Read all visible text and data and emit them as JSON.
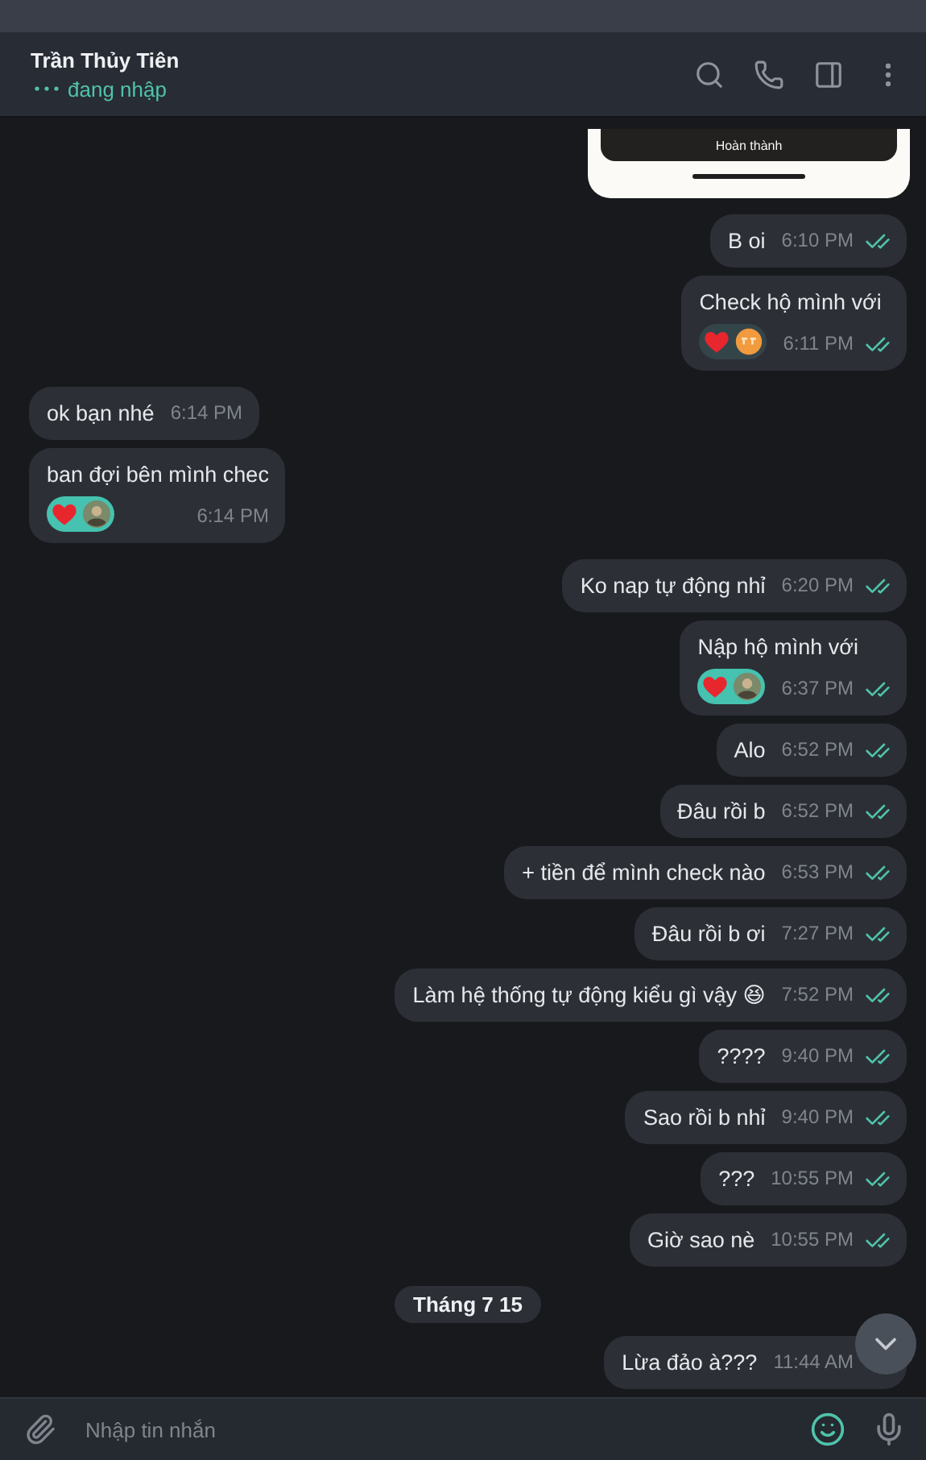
{
  "header": {
    "title": "Trần Thủy Tiên",
    "status": "đang nhập",
    "typing": true
  },
  "messages": [
    {
      "kind": "screenshot",
      "button": "Hoàn thành"
    },
    {
      "kind": "out",
      "text": "B oi",
      "time": "6:10 PM",
      "read": true
    },
    {
      "kind": "out",
      "text": "Check hộ mình với",
      "time": "6:11 PM",
      "read": true,
      "reactions": {
        "selected": false,
        "items": [
          {
            "kind": "heart"
          },
          {
            "kind": "emoji"
          }
        ]
      }
    },
    {
      "kind": "in",
      "text": "ok bạn nhé",
      "time": "6:14 PM"
    },
    {
      "kind": "in",
      "text": "ban đợi bên mình chec",
      "time": "6:14 PM",
      "reactions": {
        "selected": true,
        "items": [
          {
            "kind": "heart"
          },
          {
            "kind": "avatar"
          }
        ]
      }
    },
    {
      "kind": "out",
      "text": "Ko nap tự động nhỉ",
      "time": "6:20 PM",
      "read": true
    },
    {
      "kind": "out",
      "text": "Nập hộ mình với",
      "time": "6:37 PM",
      "read": true,
      "reactions": {
        "selected": true,
        "items": [
          {
            "kind": "heart"
          },
          {
            "kind": "avatar"
          }
        ]
      }
    },
    {
      "kind": "out",
      "text": "Alo",
      "time": "6:52 PM",
      "read": true
    },
    {
      "kind": "out",
      "text": "Đâu rồi b",
      "time": "6:52 PM",
      "read": true
    },
    {
      "kind": "out",
      "text": "+ tiền để mình check nào",
      "time": "6:53 PM",
      "read": true
    },
    {
      "kind": "out",
      "text": "Đâu rồi b ơi",
      "time": "7:27 PM",
      "read": true
    },
    {
      "kind": "out",
      "text": "Làm hệ thống tự động kiểu gì vậy 😆",
      "time": "7:52 PM",
      "read": true
    },
    {
      "kind": "out",
      "text": "????",
      "time": "9:40 PM",
      "read": true
    },
    {
      "kind": "out",
      "text": "Sao rồi b nhỉ",
      "time": "9:40 PM",
      "read": true
    },
    {
      "kind": "out",
      "text": "???",
      "time": "10:55 PM",
      "read": true
    },
    {
      "kind": "out",
      "text": "Giờ sao nè",
      "time": "10:55 PM",
      "read": true
    },
    {
      "kind": "date",
      "text": "Tháng 7 15"
    },
    {
      "kind": "out",
      "text": "Lừa đảo à???",
      "time": "11:44 AM"
    }
  ],
  "composer": {
    "placeholder": "Nhập tin nhắn"
  }
}
